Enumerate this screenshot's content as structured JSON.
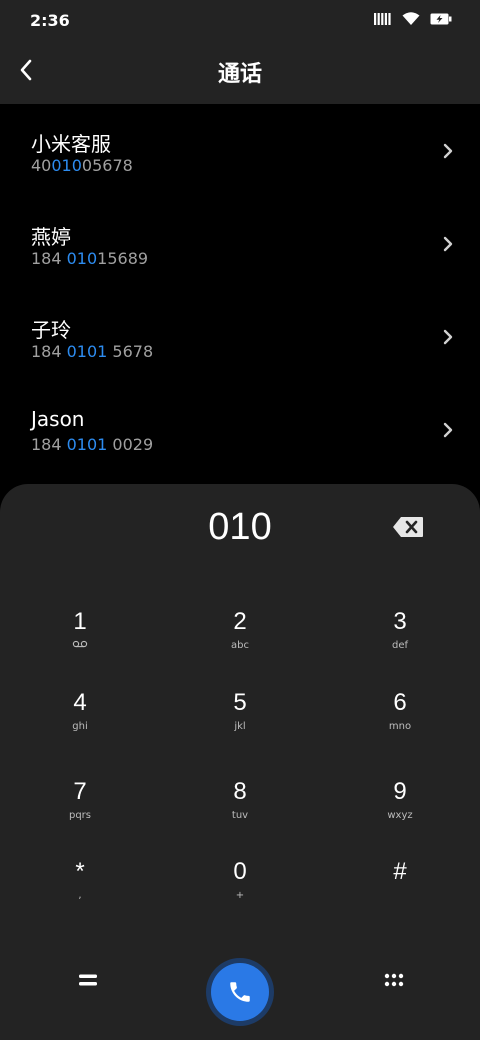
{
  "status": {
    "time": "2:36"
  },
  "header": {
    "title": "通话"
  },
  "results": [
    {
      "name": "小米客服",
      "pre": "40",
      "hl": "010",
      "post": "05678"
    },
    {
      "name": "燕婷",
      "pre": "184 ",
      "hl": "010",
      "post": "15689"
    },
    {
      "name": "子玲",
      "pre": "184 ",
      "hl": "0101",
      "post": " 5678"
    },
    {
      "name": "Jason",
      "pre": "184 ",
      "hl": "0101",
      "post": " 0029"
    }
  ],
  "dialer": {
    "input": "010",
    "keys": [
      {
        "digit": "1",
        "sub": "ಂ"
      },
      {
        "digit": "2",
        "sub": "abc"
      },
      {
        "digit": "3",
        "sub": "def"
      },
      {
        "digit": "4",
        "sub": "ghi"
      },
      {
        "digit": "5",
        "sub": "jkl"
      },
      {
        "digit": "6",
        "sub": "mno"
      },
      {
        "digit": "7",
        "sub": "pqrs"
      },
      {
        "digit": "8",
        "sub": "tuv"
      },
      {
        "digit": "9",
        "sub": "wxyz"
      },
      {
        "digit": "*",
        "sub": ","
      },
      {
        "digit": "0",
        "sub": "+"
      },
      {
        "digit": "#",
        "sub": ""
      }
    ]
  },
  "colors": {
    "highlight": "#2d8cf0",
    "call": "#2a79e6",
    "panel": "#232323"
  },
  "icons": {
    "back": "back-arrow-icon",
    "chevron": "chevron-right-icon",
    "backspace": "backspace-icon",
    "menu": "equals-menu-icon",
    "call": "phone-icon",
    "grid": "dialpad-grid-icon"
  }
}
